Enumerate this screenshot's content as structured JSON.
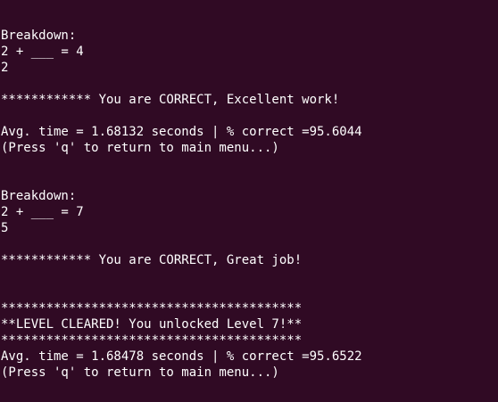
{
  "terminal": {
    "background": "#300a24",
    "foreground": "#ffffff",
    "lines": [
      "Breakdown:",
      "2 + ___ = 4",
      "2",
      "",
      "************ You are CORRECT, Excellent work!",
      "",
      "Avg. time = 1.68132 seconds | % correct =95.6044",
      "(Press 'q' to return to main menu...)",
      "",
      "",
      "Breakdown:",
      "2 + ___ = 7",
      "5",
      "",
      "************ You are CORRECT, Great job!",
      "",
      "",
      "****************************************",
      "**LEVEL CLEARED! You unlocked Level 7!**",
      "****************************************",
      "Avg. time = 1.68478 seconds | % correct =95.6522",
      "(Press 'q' to return to main menu...)"
    ]
  }
}
